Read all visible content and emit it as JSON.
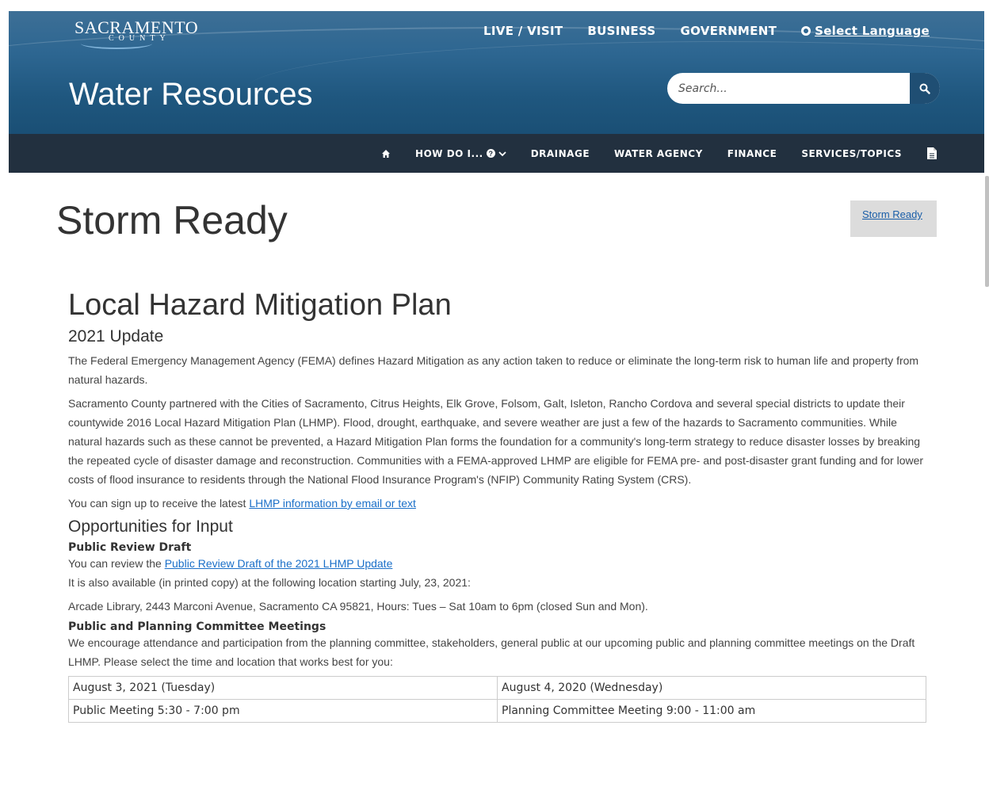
{
  "header": {
    "logo_main": "SACRAMENTO",
    "logo_sub": "COUNTY",
    "top_nav": [
      "LIVE / VISIT",
      "BUSINESS",
      "GOVERNMENT"
    ],
    "language_label": "Select Language",
    "site_title": "Water Resources",
    "search_placeholder": "Search..."
  },
  "navbar": {
    "items": [
      "HOW DO I...",
      "DRAINAGE",
      "WATER AGENCY",
      "FINANCE",
      "SERVICES/TOPICS"
    ]
  },
  "page": {
    "title": "Storm Ready",
    "breadcrumb": "Storm Ready"
  },
  "content": {
    "heading": "Local Hazard Mitigation Plan",
    "update_heading": "2021 Update",
    "para1": "The Federal Emergency Management Agency (FEMA) defines Hazard Mitigation as any action taken to reduce or eliminate the long-term risk to human life and property from natural hazards.",
    "para2": "Sacramento County partnered with the Cities of Sacramento, Citrus Heights, Elk Grove, Folsom, Galt, Isleton, Rancho Cordova and several special districts to update their countywide 2016 Local Hazard Mitigation Plan (LHMP).  Flood, drought, earthquake, and severe weather are just a few of the hazards to Sacramento communities.  While natural hazards such as these cannot be prevented, a Hazard Mitigation Plan forms the foundation for a community's long-term strategy to reduce disaster losses by breaking the repeated cycle of disaster damage and reconstruction. Communities with a FEMA-approved LHMP are eligible for FEMA pre- and post-disaster grant funding and for lower costs of flood insurance to residents through the National Flood Insurance Program's (NFIP) Community Rating System (CRS).",
    "signup_text": "You can sign up to receive the latest ",
    "signup_link": "LHMP information by email or text",
    "input_heading": "Opportunities for Input",
    "review_title": "Public Review Draft",
    "review_text": "You can review the ",
    "review_link": "Public Review Draft of the 2021 LHMP Update",
    "printed_text": "It is also available (in printed copy) at the following location starting July, 23, 2021:",
    "library_text": "Arcade Library, 2443 Marconi Avenue, Sacramento CA 95821, Hours: Tues – Sat 10am to 6pm (closed Sun and Mon).",
    "meetings_title": "Public and Planning Committee Meetings",
    "meetings_text": "We encourage attendance and participation from the planning committee, stakeholders, general public at our upcoming public and planning committee meetings on the Draft LHMP.  Please select the time and location that works best for you:",
    "table": [
      [
        "August 3, 2021 (Tuesday)",
        "August 4, 2020 (Wednesday)"
      ],
      [
        "Public Meeting 5:30 - 7:00 pm",
        "Planning Committee Meeting 9:00 - 11:00 am"
      ]
    ]
  },
  "icons": {
    "home": "home-icon",
    "question": "question-icon",
    "chevron": "chevron-down-icon",
    "document": "document-icon",
    "search": "search-icon",
    "globe": "globe-icon"
  }
}
